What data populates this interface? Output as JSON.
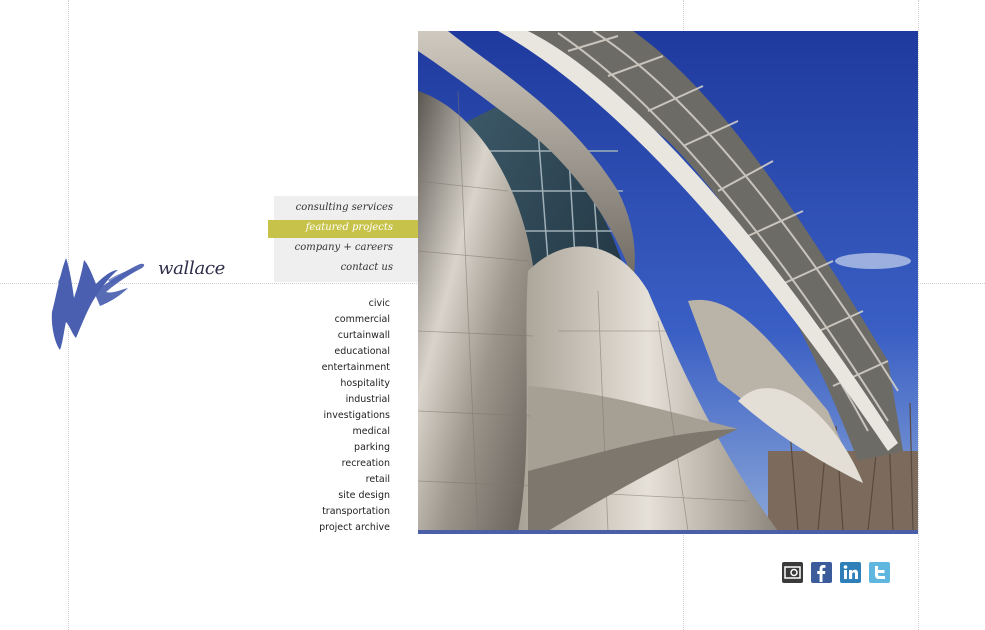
{
  "logo": {
    "text": "wallace",
    "mark_icon": "brush-w-logo-icon",
    "mark_color": "#4a5fb0"
  },
  "main_nav": [
    {
      "label": "consulting services",
      "active": false
    },
    {
      "label": "featured projects",
      "active": true
    },
    {
      "label": "company + careers",
      "active": false
    },
    {
      "label": "contact us",
      "active": false
    }
  ],
  "categories": [
    "civic",
    "commercial",
    "curtainwall",
    "educational",
    "entertainment",
    "hospitality",
    "industrial",
    "investigations",
    "medical",
    "parking",
    "recreation",
    "retail",
    "site design",
    "transportation",
    "project archive"
  ],
  "hero": {
    "subject": "stainless steel curved building facade against blue sky",
    "accent_bar_color": "#4a5fa8"
  },
  "social": [
    {
      "icon": "issuu-icon",
      "color": "#3a3a3a"
    },
    {
      "icon": "facebook-icon",
      "color": "#3b5b9a"
    },
    {
      "icon": "linkedin-icon",
      "color": "#2f7fb8"
    },
    {
      "icon": "twitter-icon",
      "color": "#5fb6de"
    }
  ],
  "colors": {
    "nav_active": "#c7c24a",
    "nav_background": "#efefef"
  }
}
